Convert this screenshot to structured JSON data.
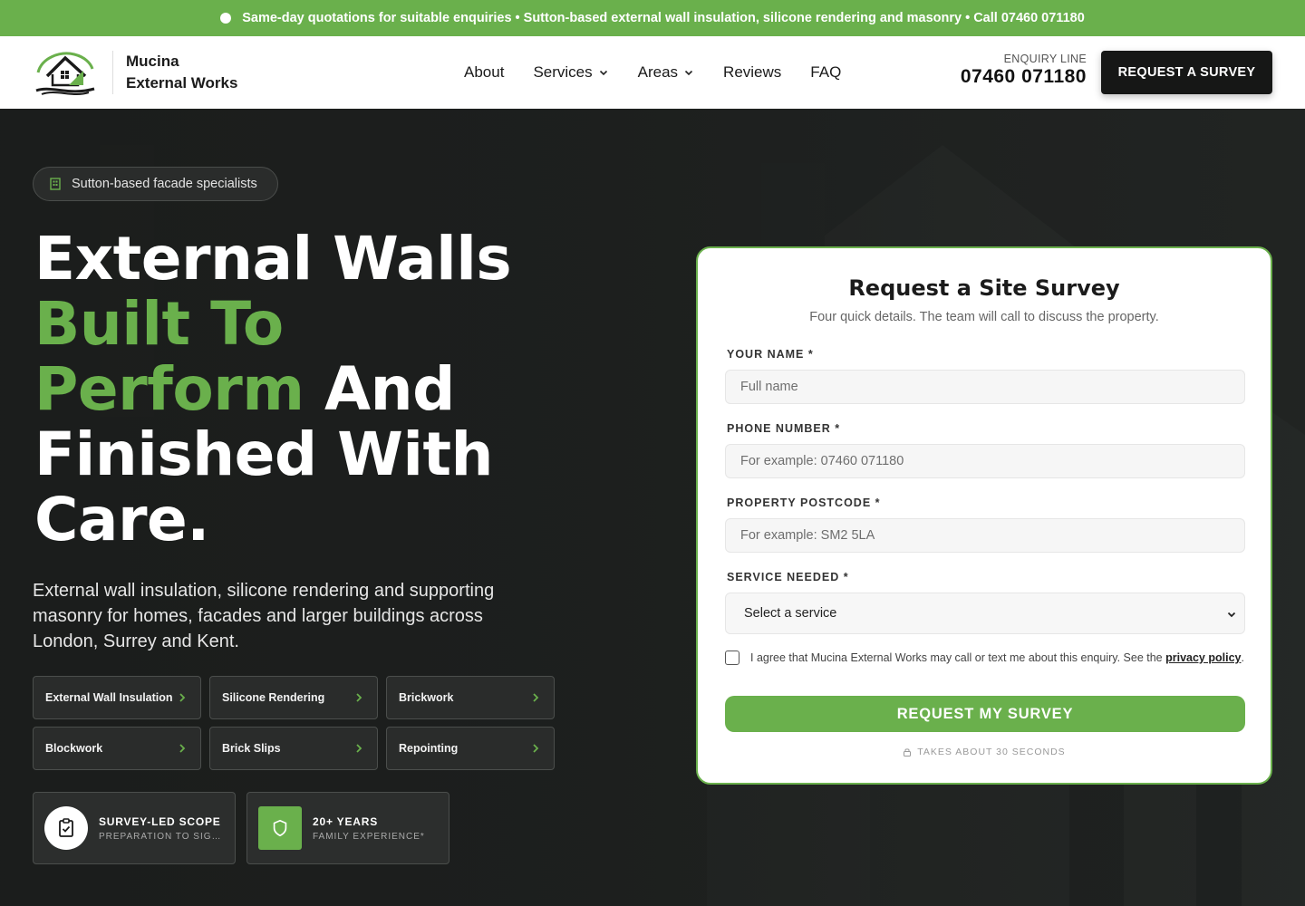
{
  "topbar": {
    "text": "Same-day quotations for suitable enquiries • Sutton-based external wall insulation, silicone rendering and masonry • Call 07460 071180"
  },
  "brand": {
    "line1": "Mucina",
    "line2": "External Works"
  },
  "nav": {
    "items": [
      {
        "label": "About",
        "dropdown": false
      },
      {
        "label": "Services",
        "dropdown": true
      },
      {
        "label": "Areas",
        "dropdown": true
      },
      {
        "label": "Reviews",
        "dropdown": false
      },
      {
        "label": "FAQ",
        "dropdown": false
      }
    ]
  },
  "enquiry": {
    "label": "ENQUIRY LINE",
    "number": "07460 071180"
  },
  "header_cta": "REQUEST A SURVEY",
  "hero": {
    "badge": "Sutton-based facade specialists",
    "headline": {
      "part1": "External Walls",
      "part2_green": "Built To",
      "part3_green": "Perform",
      "part3_white": " And",
      "part4": "Finished With",
      "part5": "Care."
    },
    "subtext": "External wall insulation, silicone rendering and supporting masonry for homes, facades and larger buildings across London, Surrey and Kent.",
    "services": [
      "External Wall Insulation",
      "Silicone Rendering",
      "Brickwork",
      "Blockwork",
      "Brick Slips",
      "Repointing"
    ],
    "stats": [
      {
        "title": "SURVEY-LED SCOPE",
        "subtitle": "PREPARATION TO SIGN-…",
        "icon": "clipboard-check-icon"
      },
      {
        "title": "20+ YEARS",
        "subtitle": "FAMILY EXPERIENCE*",
        "icon": "shield-icon"
      }
    ]
  },
  "form": {
    "title": "Request a Site Survey",
    "description": "Four quick details. The team will call to discuss the property.",
    "name_label": "YOUR NAME *",
    "name_placeholder": "Full name",
    "phone_label": "PHONE NUMBER *",
    "phone_placeholder": "For example: 07460 071180",
    "postcode_label": "PROPERTY POSTCODE *",
    "postcode_placeholder": "For example: SM2 5LA",
    "service_label": "SERVICE NEEDED *",
    "service_selected": "Select a service",
    "consent_text": "I agree that Mucina External Works may call or text me about this enquiry. See the ",
    "consent_link": "privacy policy",
    "consent_end": ".",
    "submit": "REQUEST MY SURVEY",
    "note": "TAKES ABOUT 30 SECONDS"
  },
  "colors": {
    "accent": "#6ab04c",
    "dark": "#161716"
  }
}
